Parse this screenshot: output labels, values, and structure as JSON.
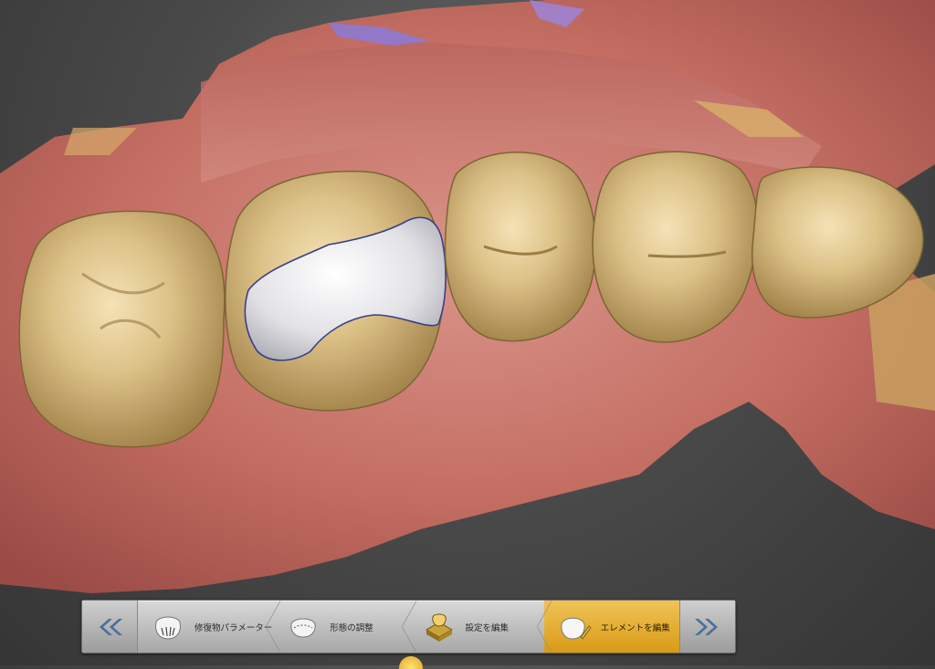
{
  "workflow": {
    "back_label": "",
    "forward_label": "",
    "steps": [
      {
        "label": "修復物パラメーター",
        "icon": "restoration-parameters-icon",
        "active": false
      },
      {
        "label": "形態の調整",
        "icon": "shape-adjust-icon",
        "active": false
      },
      {
        "label": "設定を編集",
        "icon": "settings-edit-icon",
        "active": false
      },
      {
        "label": "エレメントを編集",
        "icon": "element-edit-icon",
        "active": true
      }
    ]
  },
  "colors": {
    "accent": "#e6ac2c",
    "gum": "#c9706a",
    "tooth": "#d8bd84",
    "restoration": "#e3e3e6",
    "background": "#4a4a4a"
  }
}
